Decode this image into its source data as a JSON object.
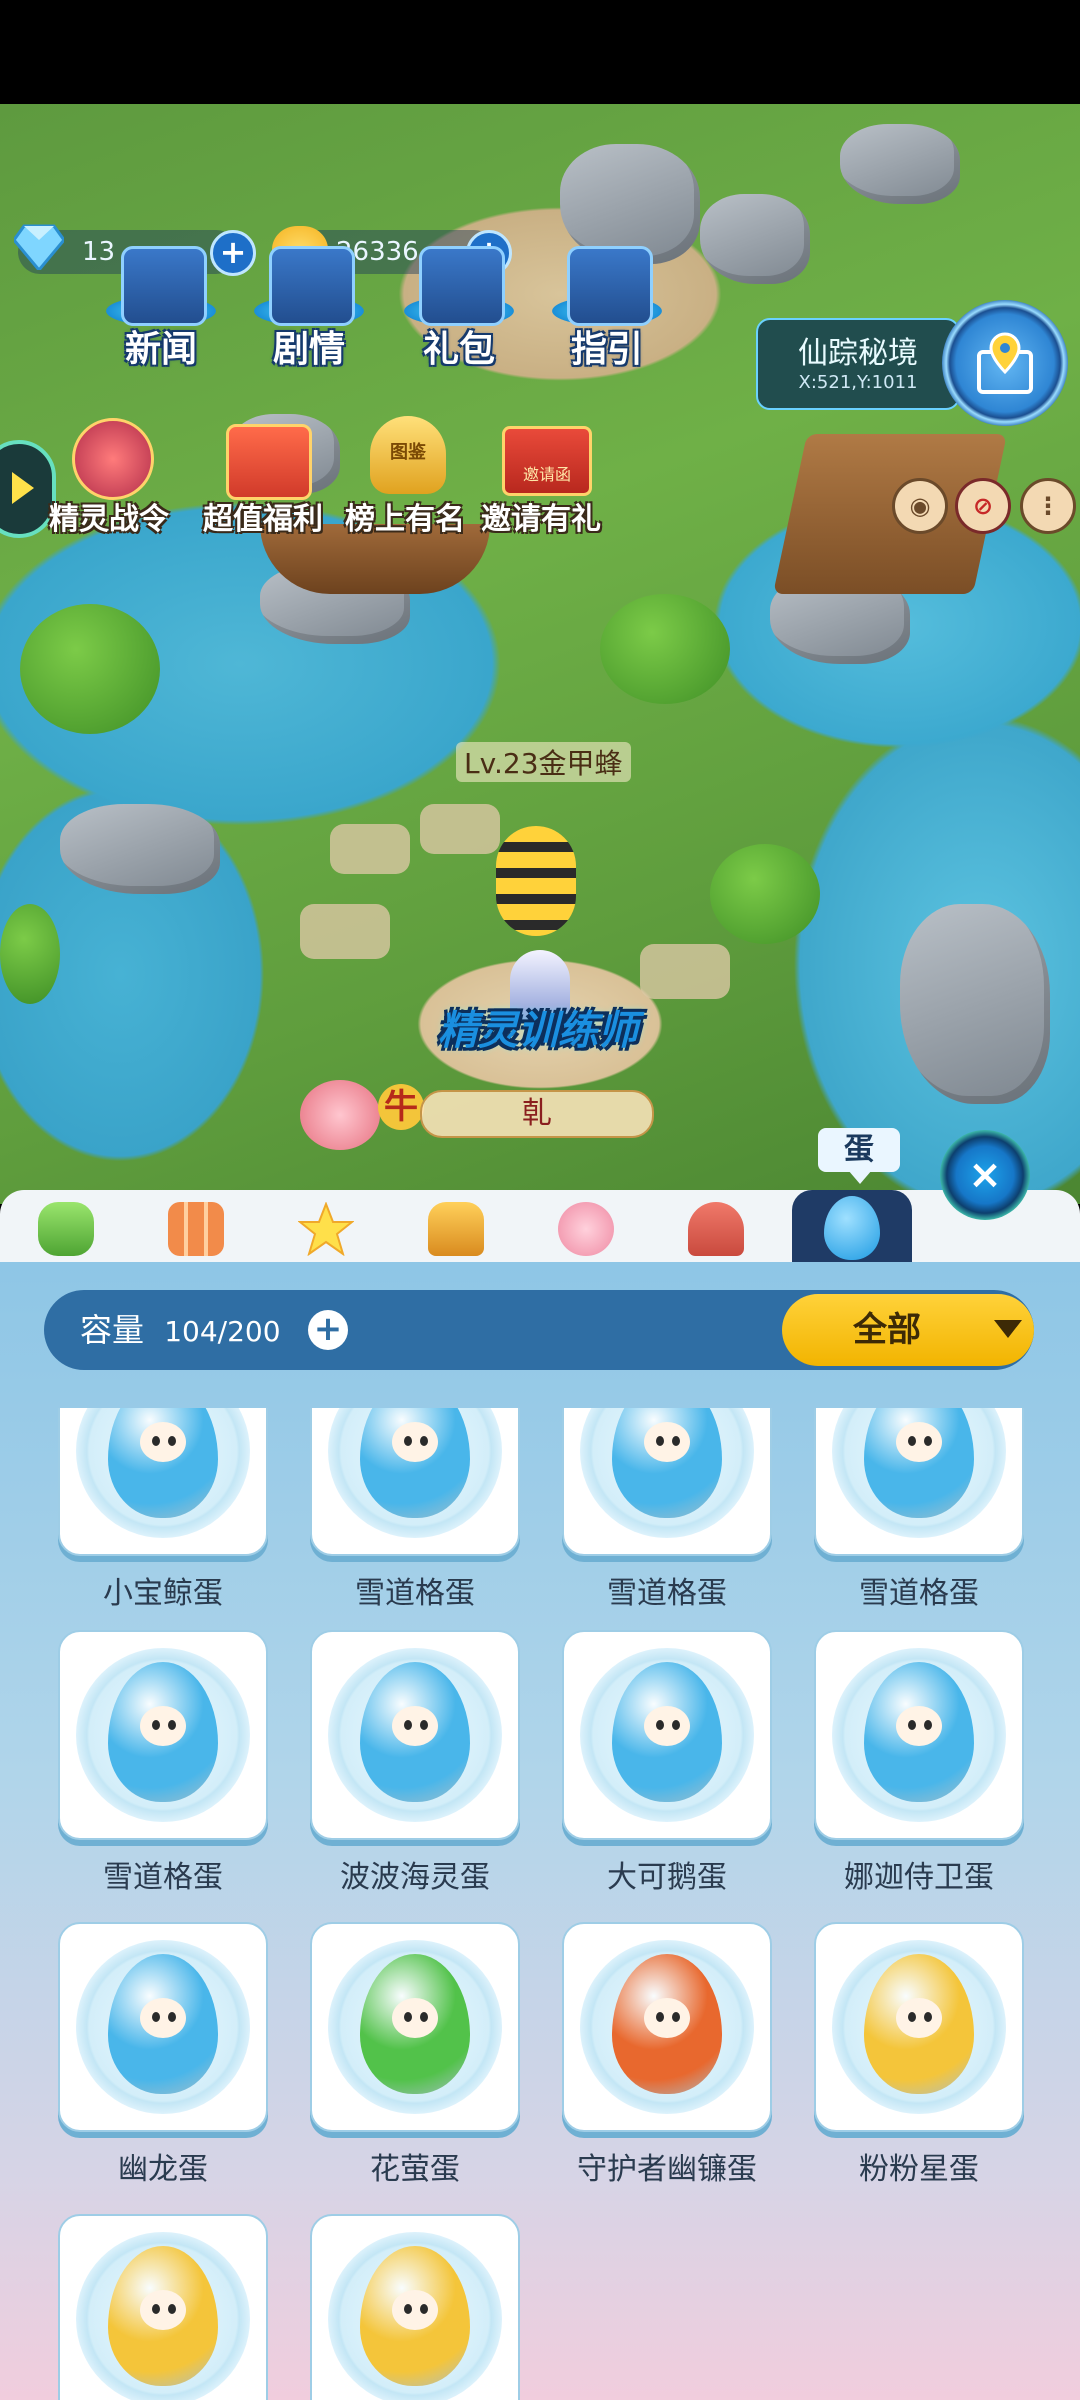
{
  "currency": {
    "gems": "13",
    "coins": "26336"
  },
  "top_menu": [
    {
      "label": "新闻",
      "icon": "news-icon"
    },
    {
      "label": "剧情",
      "icon": "story-icon"
    },
    {
      "label": "礼包",
      "icon": "gift-pack-icon"
    },
    {
      "label": "指引",
      "icon": "guide-icon"
    }
  ],
  "second_menu": [
    {
      "label": "精灵战令",
      "icon": "battle-pass-icon"
    },
    {
      "label": "超值福利",
      "icon": "welfare-icon"
    },
    {
      "label": "榜上有名",
      "icon": "ranking-trophy-icon"
    },
    {
      "label": "邀请有礼",
      "icon": "invite-icon"
    }
  ],
  "trophy_text": "图鉴",
  "invite_text": "邀请函",
  "location": {
    "name": "仙踪秘境",
    "coords": "X:521,Y:1011"
  },
  "character": {
    "pet_label": "Lv.23金甲蜂",
    "title": "精灵训练师",
    "player_name": "乹",
    "niu": "牛"
  },
  "tabs": [
    {
      "icon": "battery-icon",
      "color": "#7ccf5a"
    },
    {
      "icon": "blocks-icon",
      "color": "#f08a4a"
    },
    {
      "icon": "star-icon",
      "color": "#ffe04a"
    },
    {
      "icon": "badge-icon",
      "color": "#f2b04a"
    },
    {
      "icon": "costume-icon",
      "color": "#f29aaa"
    },
    {
      "icon": "rocking-horse-icon",
      "color": "#e8625a"
    },
    {
      "icon": "egg-icon",
      "color": "#4fb8f0"
    }
  ],
  "active_tab_tip": "蛋",
  "capacity": {
    "label": "容量",
    "value": "104/200"
  },
  "filter": {
    "selected": "全部"
  },
  "eggs": [
    {
      "name": "小宝鲸蛋",
      "color": "#49b6ea"
    },
    {
      "name": "雪道格蛋",
      "color": "#49b6ea"
    },
    {
      "name": "雪道格蛋",
      "color": "#49b6ea"
    },
    {
      "name": "雪道格蛋",
      "color": "#49b6ea"
    },
    {
      "name": "雪道格蛋",
      "color": "#49b6ea"
    },
    {
      "name": "波波海灵蛋",
      "color": "#49b6ea"
    },
    {
      "name": "大可鹅蛋",
      "color": "#49b6ea"
    },
    {
      "name": "娜迦侍卫蛋",
      "color": "#49b6ea"
    },
    {
      "name": "幽龙蛋",
      "color": "#49b6ea"
    },
    {
      "name": "花萤蛋",
      "color": "#52c24a"
    },
    {
      "name": "守护者幽镰蛋",
      "color": "#e8682e"
    },
    {
      "name": "粉粉星蛋",
      "color": "#f4c53a"
    },
    {
      "name": "",
      "color": "#f4c53a"
    },
    {
      "name": "",
      "color": "#f4c53a"
    }
  ]
}
